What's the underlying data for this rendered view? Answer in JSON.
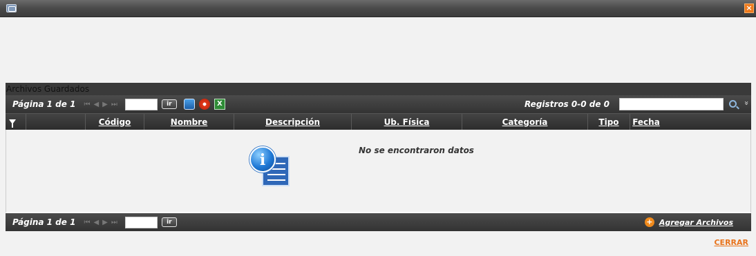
{
  "window": {
    "close_glyph": "×",
    "icon": "window-icon"
  },
  "panel": {
    "title": "Archivos Guardados"
  },
  "pager_top": {
    "page_label": "Página 1 de 1",
    "go_label": "ir",
    "records_label": "Registros 0-0 de 0",
    "page_value": "",
    "search_value": ""
  },
  "nav": {
    "first": "⏮",
    "prev": "◀",
    "next": "▶",
    "last": "⏭"
  },
  "columns": [
    "",
    "",
    "Código",
    "Nombre",
    "Descripción",
    "Ub. Física",
    "Categoría",
    "Tipo",
    "Fecha"
  ],
  "table": {
    "rows": [],
    "empty_message": "No se encontraron datos"
  },
  "pager_bottom": {
    "page_label": "Página 1 de 1",
    "go_label": "ir",
    "add_files_label": "Agregar Archivos"
  },
  "footer": {
    "close_label": "CERRAR"
  },
  "colors": {
    "accent": "#e8731b",
    "header_bg": "#333333",
    "body_bg": "#f2f2f2"
  }
}
